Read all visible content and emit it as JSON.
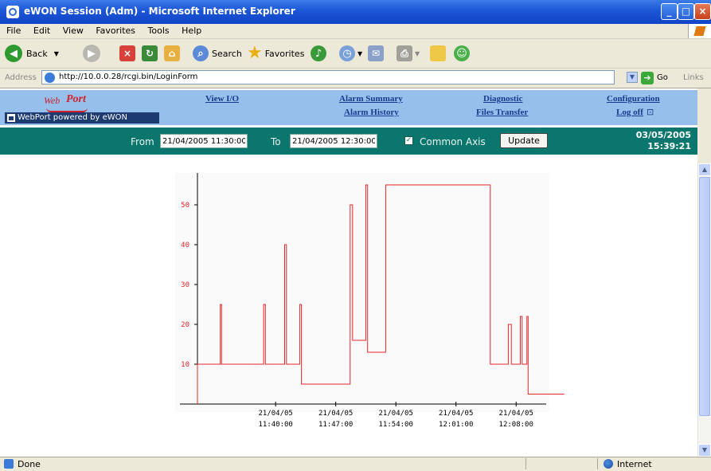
{
  "window": {
    "title": "eWON Session (Adm) - Microsoft Internet Explorer"
  },
  "menu": [
    "File",
    "Edit",
    "View",
    "Favorites",
    "Tools",
    "Help"
  ],
  "toolbar": {
    "back_label": "Back",
    "search_label": "Search",
    "favorites_label": "Favorites"
  },
  "address": {
    "label": "Address",
    "url": "http://10.0.0.28/rcgi.bin/LoginForm",
    "go_label": "Go",
    "links_label": "Links"
  },
  "webport": {
    "logo_web": "Web",
    "logo_port": "Port",
    "powered_by": "WebPort powered by eWON",
    "nav": {
      "view_io": "View I/O",
      "alarm_summary": "Alarm Summary",
      "alarm_history": "Alarm History",
      "diagnostic": "Diagnostic",
      "files_transfer": "Files Transfer",
      "configuration": "Configuration",
      "log_off": "Log off"
    }
  },
  "filter": {
    "from_label": "From",
    "from_value": "21/04/2005 11:30:00",
    "to_label": "To",
    "to_value": "21/04/2005 12:30:00",
    "common_axis_label": "Common Axis",
    "common_axis_checked": true,
    "update_label": "Update",
    "date": "03/05/2005",
    "time": "15:39:21"
  },
  "chart_data": {
    "type": "line",
    "ylim": [
      0,
      58
    ],
    "xlim": [
      0,
      58
    ],
    "yticks": [
      10,
      20,
      30,
      40,
      50
    ],
    "xticks": [
      {
        "x": 13,
        "date": "21/04/05",
        "time": "11:40:00"
      },
      {
        "x": 23,
        "date": "21/04/05",
        "time": "11:47:00"
      },
      {
        "x": 33,
        "date": "21/04/05",
        "time": "11:54:00"
      },
      {
        "x": 43,
        "date": "21/04/05",
        "time": "12:01:00"
      },
      {
        "x": 53,
        "date": "21/04/05",
        "time": "12:08:00"
      }
    ],
    "color": "#e8262a",
    "grid": false,
    "series": [
      {
        "points": [
          [
            0,
            0
          ],
          [
            0,
            10
          ],
          [
            3.8,
            10
          ],
          [
            3.8,
            25
          ],
          [
            4,
            25
          ],
          [
            4,
            10
          ],
          [
            11,
            10
          ],
          [
            11,
            25
          ],
          [
            11.3,
            25
          ],
          [
            11.3,
            10
          ],
          [
            14.5,
            10
          ],
          [
            14.5,
            40
          ],
          [
            14.8,
            40
          ],
          [
            14.8,
            10
          ],
          [
            17,
            10
          ],
          [
            17,
            25
          ],
          [
            17.3,
            25
          ],
          [
            17.3,
            5
          ],
          [
            25.4,
            5
          ],
          [
            25.4,
            50
          ],
          [
            25.8,
            50
          ],
          [
            25.8,
            16
          ],
          [
            28,
            16
          ],
          [
            28,
            55
          ],
          [
            28.3,
            55
          ],
          [
            28.3,
            13
          ],
          [
            31.3,
            13
          ],
          [
            31.3,
            55
          ],
          [
            48.7,
            55
          ],
          [
            48.7,
            10
          ],
          [
            51.7,
            10
          ],
          [
            51.7,
            20
          ],
          [
            52.2,
            20
          ],
          [
            52.2,
            10
          ],
          [
            53.7,
            10
          ],
          [
            53.7,
            22
          ],
          [
            54,
            22
          ],
          [
            54,
            10
          ],
          [
            54.8,
            10
          ],
          [
            54.8,
            22
          ],
          [
            55,
            22
          ],
          [
            55,
            2.5
          ],
          [
            61,
            2.5
          ]
        ]
      }
    ]
  },
  "status": {
    "text": "Done",
    "zone": "Internet"
  }
}
